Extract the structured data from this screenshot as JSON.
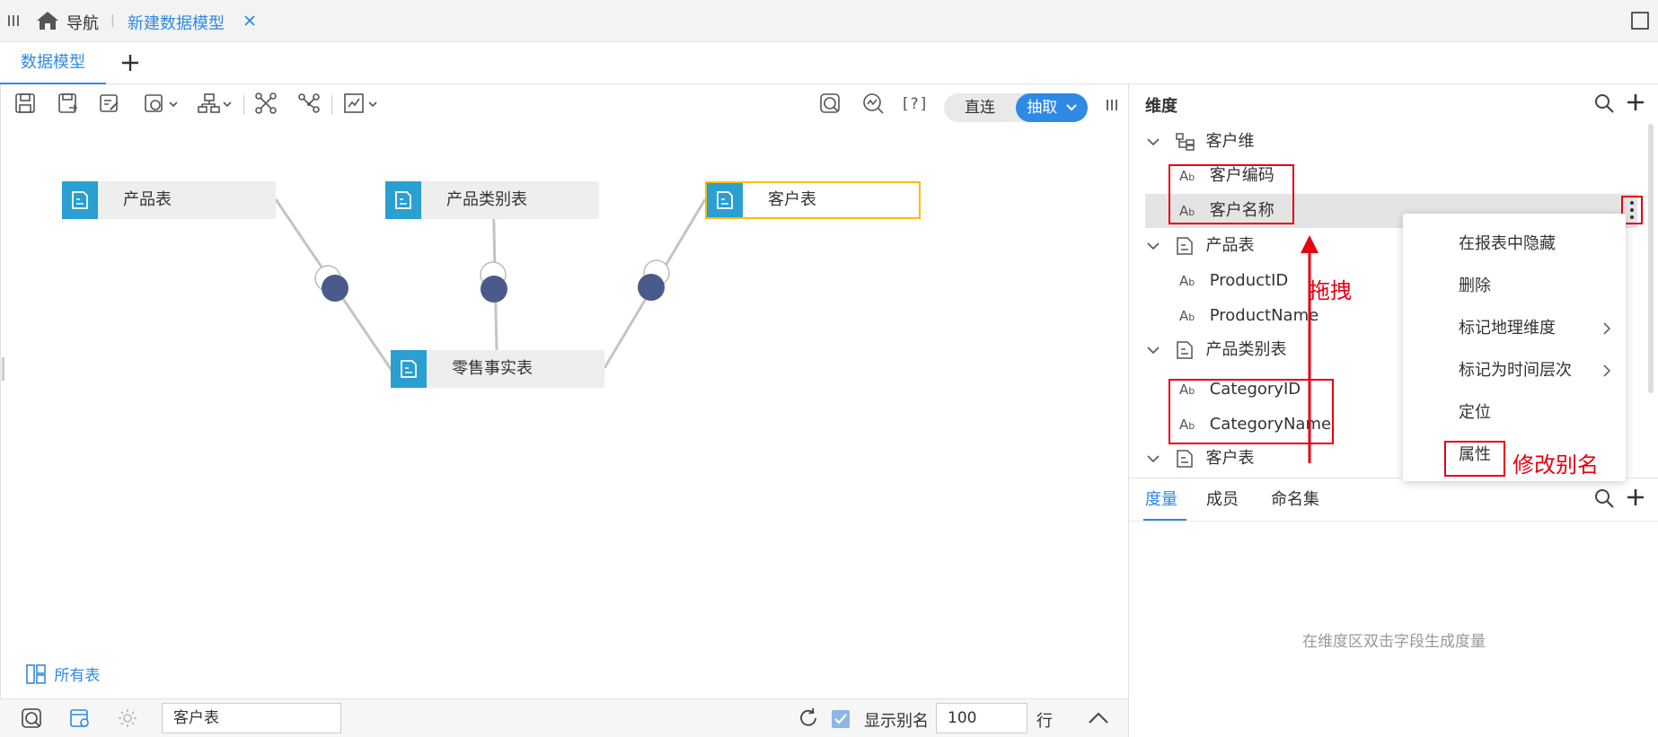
{
  "topbar": {
    "nav_label": "导航",
    "separator": "|",
    "doc_tab_label": "新建数据模型"
  },
  "tabs": {
    "active_label": "数据模型"
  },
  "toolbar": {
    "help_label": "[?]",
    "mode_direct": "直连",
    "mode_extract": "抽取"
  },
  "canvas": {
    "nodes": {
      "product": "产品表",
      "category": "产品类别表",
      "customer": "客户表",
      "fact": "零售事实表"
    },
    "all_tables_label": "所有表"
  },
  "bottombar": {
    "table_input_value": "客户表",
    "show_alias_label": "显示别名",
    "show_alias_checked": true,
    "rows_value": "100",
    "rows_unit": "行"
  },
  "dimension_panel": {
    "title": "维度",
    "groups": [
      {
        "label": "客户维",
        "items": [
          "客户编码",
          "客户名称"
        ]
      },
      {
        "label": "产品表",
        "items": [
          "ProductID",
          "ProductName"
        ]
      },
      {
        "label": "产品类别表",
        "items": [
          "CategoryID",
          "CategoryName"
        ]
      },
      {
        "label": "客户表",
        "items": []
      }
    ],
    "field_type_glyph": "A",
    "field_type_sub": "b"
  },
  "context_menu": {
    "items": [
      "在报表中隐藏",
      "删除",
      "标记地理维度",
      "标记为时间层次",
      "定位",
      "属性"
    ]
  },
  "annotations": {
    "drag": "拖拽",
    "rename": "修改别名"
  },
  "measure_panel": {
    "tabs": [
      "度量",
      "成员",
      "命名集"
    ],
    "empty_hint": "在维度区双击字段生成度量"
  },
  "colors": {
    "accent": "#2f8ae5",
    "node_icon": "#2a9fd0",
    "join_dot": "#4a5a8a",
    "highlight_border": "#f5c000",
    "annotation_red": "#e60012"
  }
}
